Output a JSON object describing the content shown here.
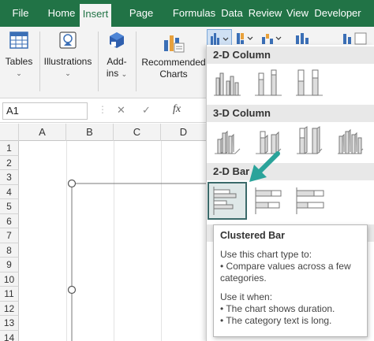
{
  "tabs": [
    {
      "label": "File",
      "active": false
    },
    {
      "label": "Home",
      "active": false
    },
    {
      "label": "Insert",
      "active": true
    },
    {
      "label": "Page Layout",
      "active": false
    },
    {
      "label": "Formulas",
      "active": false
    },
    {
      "label": "Data",
      "active": false
    },
    {
      "label": "Review",
      "active": false
    },
    {
      "label": "View",
      "active": false
    },
    {
      "label": "Developer",
      "active": false
    }
  ],
  "ribbon": {
    "tables": "Tables",
    "illustrations": "Illustrations",
    "addins_line1": "Add-",
    "addins_line2": "ins",
    "recommended_line1": "Recommended",
    "recommended_line2": "Charts"
  },
  "formula_bar": {
    "name_box": "A1",
    "cancel_symbol": "✕",
    "enter_symbol": "✓",
    "fx": "fx"
  },
  "grid": {
    "columns": [
      "A",
      "B",
      "C",
      "D"
    ],
    "rows": [
      "1",
      "2",
      "3",
      "4",
      "5",
      "6",
      "7",
      "8",
      "9",
      "10",
      "11",
      "12",
      "13",
      "14"
    ]
  },
  "chart_menu": {
    "sections": [
      "2-D Column",
      "3-D Column",
      "2-D Bar"
    ],
    "selected_item": "Clustered Bar"
  },
  "tooltip": {
    "title": "Clustered Bar",
    "intro": "Use this chart type to:",
    "bullet1": "• Compare values across a few categories.",
    "when": "Use it when:",
    "bullet2": "• The chart shows duration.",
    "bullet3": "• The category text is long."
  },
  "colors": {
    "excel_green": "#217346",
    "selection_border": "#3b6a6a",
    "arrow_teal": "#2aa39a"
  }
}
